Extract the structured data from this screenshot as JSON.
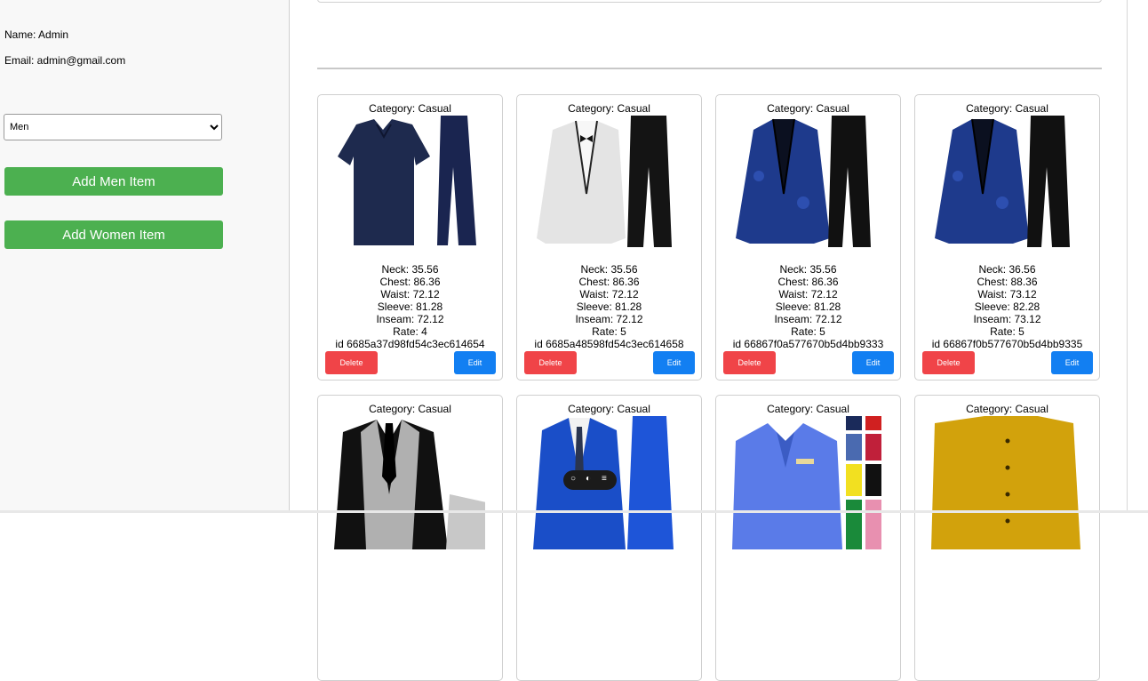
{
  "sidebar": {
    "name_text": "Name: Admin",
    "email_text": "Email: admin@gmail.com",
    "gender_select": {
      "selected": "Men",
      "options": [
        "Men"
      ]
    },
    "add_men_label": "Add Men Item",
    "add_women_label": "Add Women Item",
    "accent_green": "#4cb050"
  },
  "cards": [
    {
      "category": "Category: Casual",
      "neck": "Neck: 35.56",
      "chest": "Chest: 86.36",
      "waist": "Waist: 72.12",
      "sleeve": "Sleeve: 81.28",
      "inseam": "Inseam: 72.12",
      "rate": "Rate: 4",
      "id": "id 6685a37d98fd54c3ec614654",
      "delete_label": "Delete",
      "edit_label": "Edit",
      "image": "navy-scrubs-shirt-and-pants"
    },
    {
      "category": "Category: Casual",
      "neck": "Neck: 35.56",
      "chest": "Chest: 86.36",
      "waist": "Waist: 72.12",
      "sleeve": "Sleeve: 81.28",
      "inseam": "Inseam: 72.12",
      "rate": "Rate: 5",
      "id": "id 6685a48598fd54c3ec614658",
      "delete_label": "Delete",
      "edit_label": "Edit",
      "image": "white-tuxedo-jacket-black-pants"
    },
    {
      "category": "Category: Casual",
      "neck": "Neck: 35.56",
      "chest": "Chest: 86.36",
      "waist": "Waist: 72.12",
      "sleeve": "Sleeve: 81.28",
      "inseam": "Inseam: 72.12",
      "rate": "Rate: 5",
      "id": "id 66867f0a577670b5d4bb9333",
      "delete_label": "Delete",
      "edit_label": "Edit",
      "image": "blue-paisley-blazer-black-pants"
    },
    {
      "category": "Category: Casual",
      "neck": "Neck: 36.56",
      "chest": "Chest: 88.36",
      "waist": "Waist: 73.12",
      "sleeve": "Sleeve: 82.28",
      "inseam": "Inseam: 73.12",
      "rate": "Rate: 5",
      "id": "id 66867f0b577670b5d4bb9335",
      "delete_label": "Delete",
      "edit_label": "Edit",
      "image": "blue-paisley-blazer-black-pants"
    },
    {
      "category": "Category: Casual",
      "image": "black-grey-three-piece-suit"
    },
    {
      "category": "Category: Casual",
      "image": "royal-blue-suit"
    },
    {
      "category": "Category: Casual",
      "image": "blue-shirts-color-grid"
    },
    {
      "category": "Category: Casual",
      "image": "mustard-jacket"
    }
  ],
  "colors": {
    "delete": "#f04448",
    "edit": "#127ff2"
  },
  "floating_toolbar": {
    "icons": [
      "chat-icon",
      "toggle-icon",
      "list-icon"
    ]
  }
}
